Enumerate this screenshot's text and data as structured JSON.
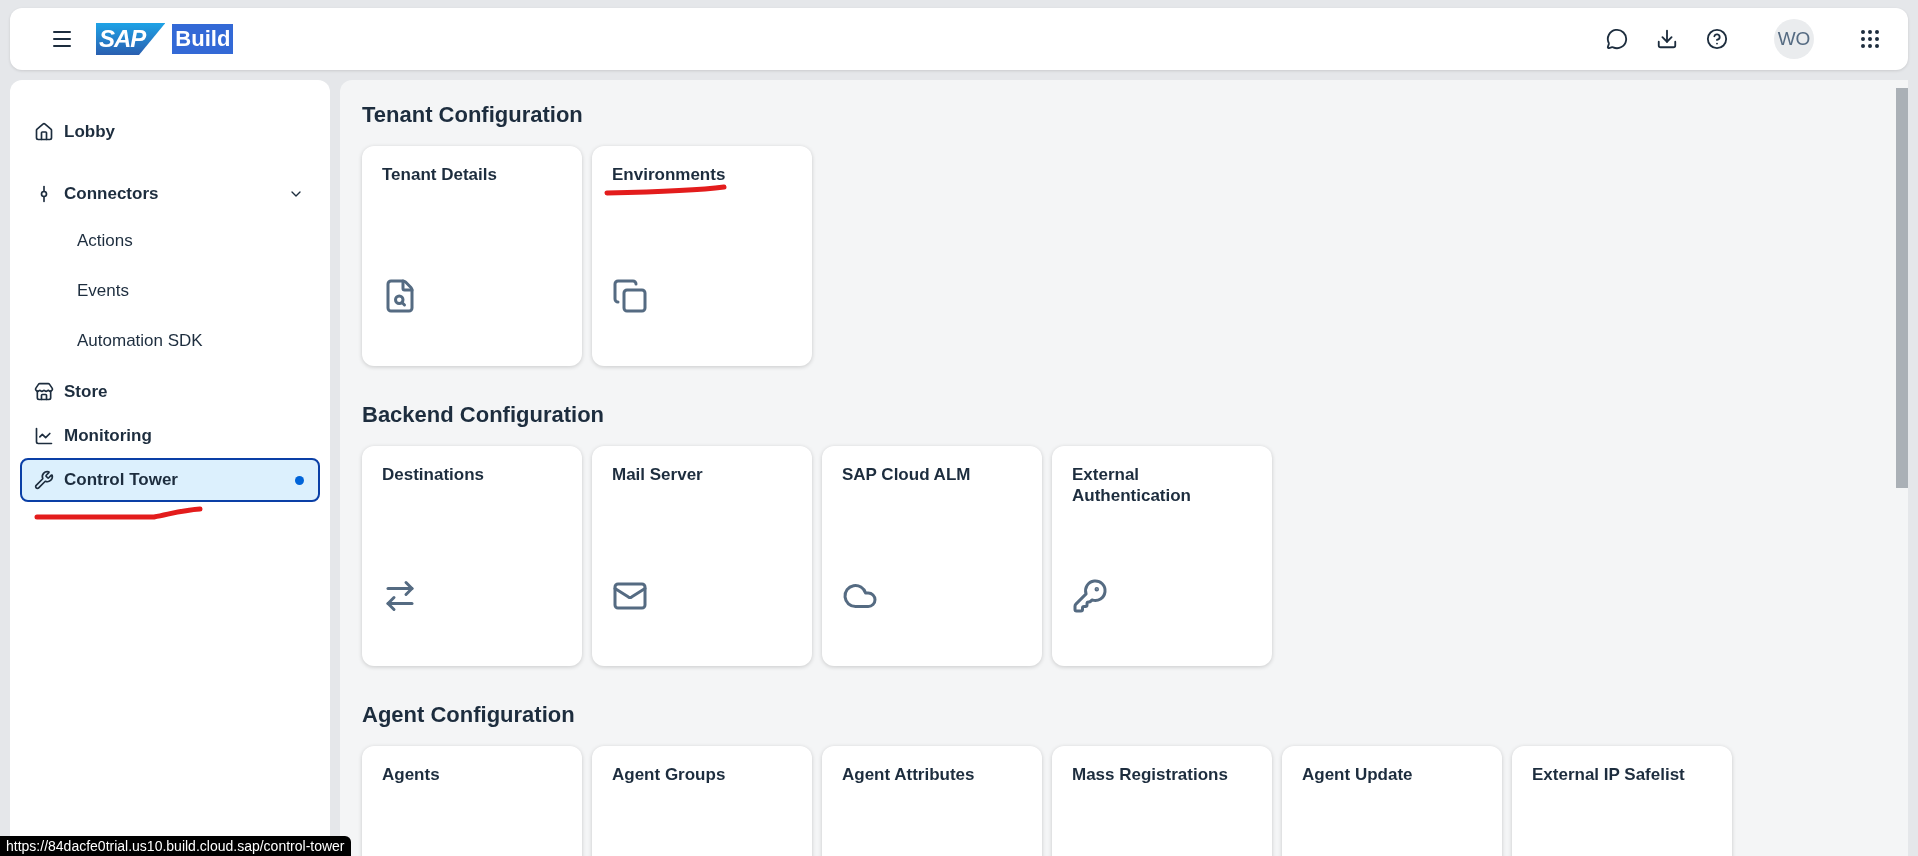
{
  "header": {
    "logo": {
      "brand": "SAP",
      "product": "Build"
    },
    "avatar": "WO"
  },
  "sidebar": {
    "items": [
      {
        "label": "Lobby",
        "selected": false
      },
      {
        "label": "Connectors",
        "selected": false,
        "expanded": true,
        "children": [
          {
            "label": "Actions",
            "selected": false
          },
          {
            "label": "Events",
            "selected": false
          },
          {
            "label": "Automation SDK",
            "selected": false
          }
        ]
      },
      {
        "label": "Store",
        "selected": false
      },
      {
        "label": "Monitoring",
        "selected": false
      },
      {
        "label": "Control Tower",
        "selected": true
      }
    ]
  },
  "sections": [
    {
      "title": "Tenant Configuration",
      "cards": [
        {
          "title": "Tenant Details"
        },
        {
          "title": "Environments"
        }
      ]
    },
    {
      "title": "Backend Configuration",
      "cards": [
        {
          "title": "Destinations"
        },
        {
          "title": "Mail Server"
        },
        {
          "title": "SAP Cloud ALM"
        },
        {
          "title": "External Authentication"
        }
      ]
    },
    {
      "title": "Agent Configuration",
      "cards": [
        {
          "title": "Agents"
        },
        {
          "title": "Agent Groups"
        },
        {
          "title": "Agent Attributes"
        },
        {
          "title": "Mass Registrations"
        },
        {
          "title": "Agent Update"
        },
        {
          "title": "External IP Safelist"
        }
      ]
    }
  ],
  "status_url": "https://84dacfe0trial.us10.build.cloud.sap/control-tower"
}
